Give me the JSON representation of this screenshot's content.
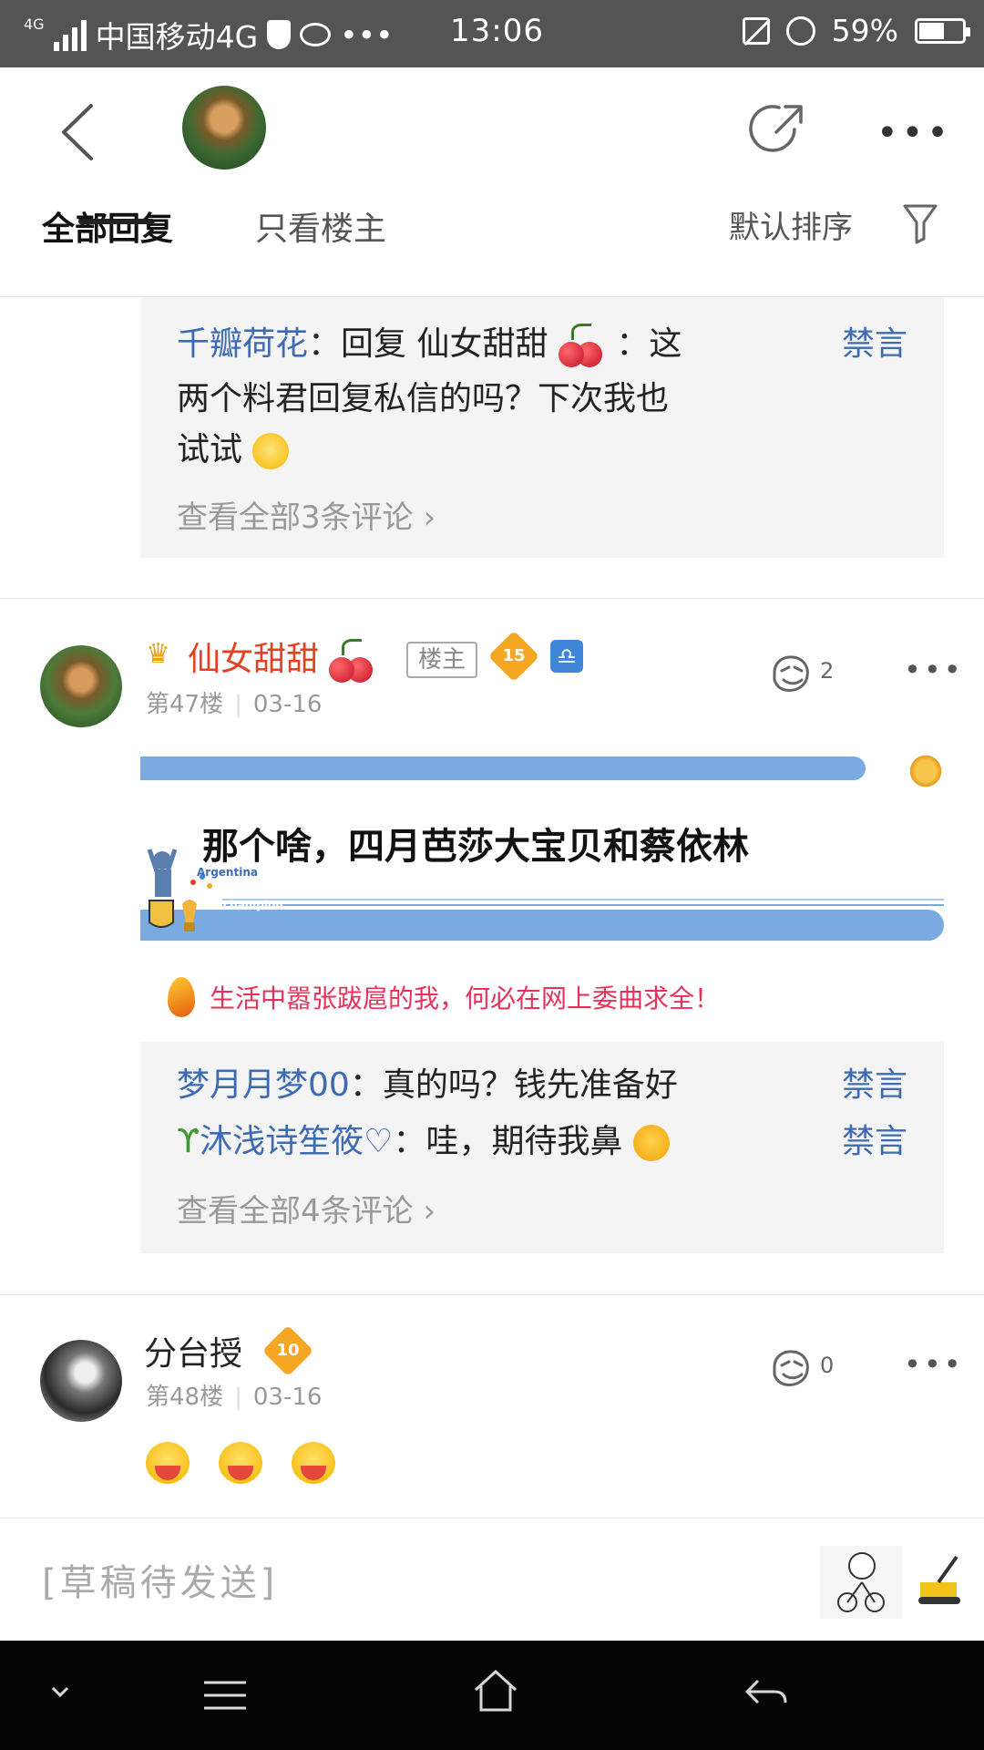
{
  "status_bar": {
    "network": "4G",
    "carrier": "中国移动4G",
    "extra": "•••",
    "time": "13:06",
    "battery_text": "59%",
    "battery_level": 0.59
  },
  "header": {
    "tabs": [
      {
        "label": "全部回复",
        "active": true
      },
      {
        "label": "只看楼主",
        "active": false
      }
    ],
    "sort_label": "默认排序"
  },
  "box1": {
    "rows": [
      {
        "user": "千瓣荷花",
        "sep": "：",
        "text": "回复 仙女甜甜",
        "tail": " ：这",
        "ban": "禁言"
      },
      {
        "text": "两个料君回复私信的吗？下次我也"
      },
      {
        "text": "试试"
      }
    ],
    "view_all": "查看全部3条评论"
  },
  "post47": {
    "username": "仙女甜甜",
    "owner_tag": "楼主",
    "level": "15",
    "floor": "第47楼",
    "date": "03-16",
    "likes": "2",
    "banner_text": "那个啥，四月芭莎大宝贝和蔡依林",
    "banner_small1": "Argentina",
    "banner_small2": "1978",
    "banner_small3": "The champion",
    "signature": "生活中嚣张跋扈的我，何必在网上委曲求全！"
  },
  "box2": {
    "rows": [
      {
        "user": "梦月月梦00",
        "sep": "：",
        "text": "真的吗？钱先准备好",
        "ban": "禁言"
      },
      {
        "user": "沐浅诗笙筱",
        "sep": "：",
        "text": "哇，期待我鼻",
        "ban": "禁言"
      }
    ],
    "view_all": "查看全部4条评论"
  },
  "post48": {
    "username": "分台授",
    "level": "10",
    "floor": "第48楼",
    "date": "03-16",
    "likes": "0"
  },
  "input": {
    "draft": "[草稿待发送]"
  },
  "colors": {
    "link_blue": "#3d6bb3",
    "name_red": "#e3411f",
    "signature_pink": "#e9305a",
    "banner_blue": "#7aaae0"
  }
}
